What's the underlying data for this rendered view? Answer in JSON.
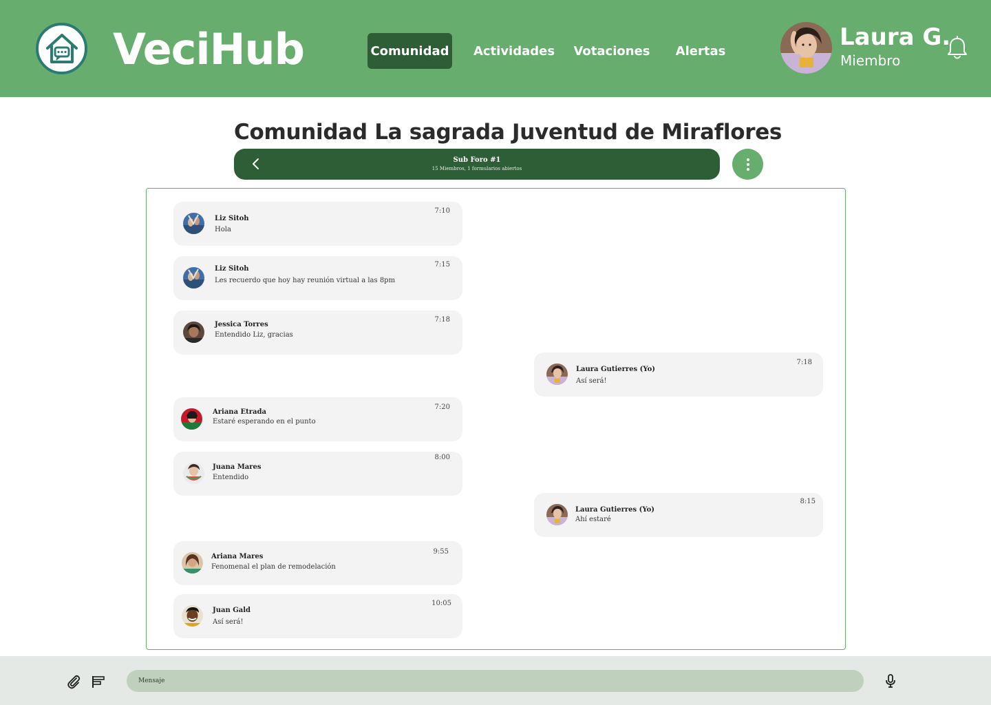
{
  "header": {
    "brand": "VeciHub",
    "nav": [
      {
        "label": "Comunidad",
        "active": true
      },
      {
        "label": "Actividades",
        "active": false
      },
      {
        "label": "Votaciones",
        "active": false
      },
      {
        "label": "Alertas",
        "active": false
      }
    ],
    "user": {
      "name": "Laura G.",
      "role": "Miembro"
    },
    "icons": {
      "logo": "house-chat-icon",
      "notifications": "bell-icon"
    }
  },
  "forum": {
    "title": "Comunidad La sagrada Juventud de Miraflores",
    "subforum_name": "Sub Foro #1",
    "subforum_meta": "15 Miembros, 1 formularios abiertos",
    "icons": {
      "back": "chevron-left-icon",
      "menu": "kebab-menu-icon"
    }
  },
  "messages": [
    {
      "author": "Liz Sitoh",
      "text": "Hola",
      "time": "7:10",
      "side": "left"
    },
    {
      "author": "Liz Sitoh",
      "text": "Les recuerdo que hoy hay reunión virtual a las 8pm",
      "time": "7:15",
      "side": "left"
    },
    {
      "author": "Jessica Torres",
      "text": "Entendido Liz, gracias",
      "time": "7:18",
      "side": "left"
    },
    {
      "author": "Laura Gutierres (Yo)",
      "text": "Así será!",
      "time": "7:18",
      "side": "right"
    },
    {
      "author": "Ariana Etrada",
      "text": "Estaré esperando en el punto",
      "time": "7:20",
      "side": "left"
    },
    {
      "author": "Juana Mares",
      "text": "Entendido",
      "time": "8:00",
      "side": "left"
    },
    {
      "author": "Laura Gutierres (Yo)",
      "text": "Ahí estaré",
      "time": "8:15",
      "side": "right"
    },
    {
      "author": "Ariana Mares",
      "text": "Fenomenal el plan de remodelación",
      "time": "9:55",
      "side": "left"
    },
    {
      "author": "Juan Gald",
      "text": "Así será!",
      "time": "10:05",
      "side": "left"
    }
  ],
  "composer": {
    "placeholder": "Mensaje",
    "icons": {
      "attach": "paperclip-icon",
      "format": "text-align-icon",
      "voice": "microphone-icon"
    }
  },
  "colors": {
    "header_green": "#66ad6e",
    "dark_green": "#2d5e35",
    "input_green": "#bfd1bc",
    "bubble": "#f3f3f3"
  }
}
